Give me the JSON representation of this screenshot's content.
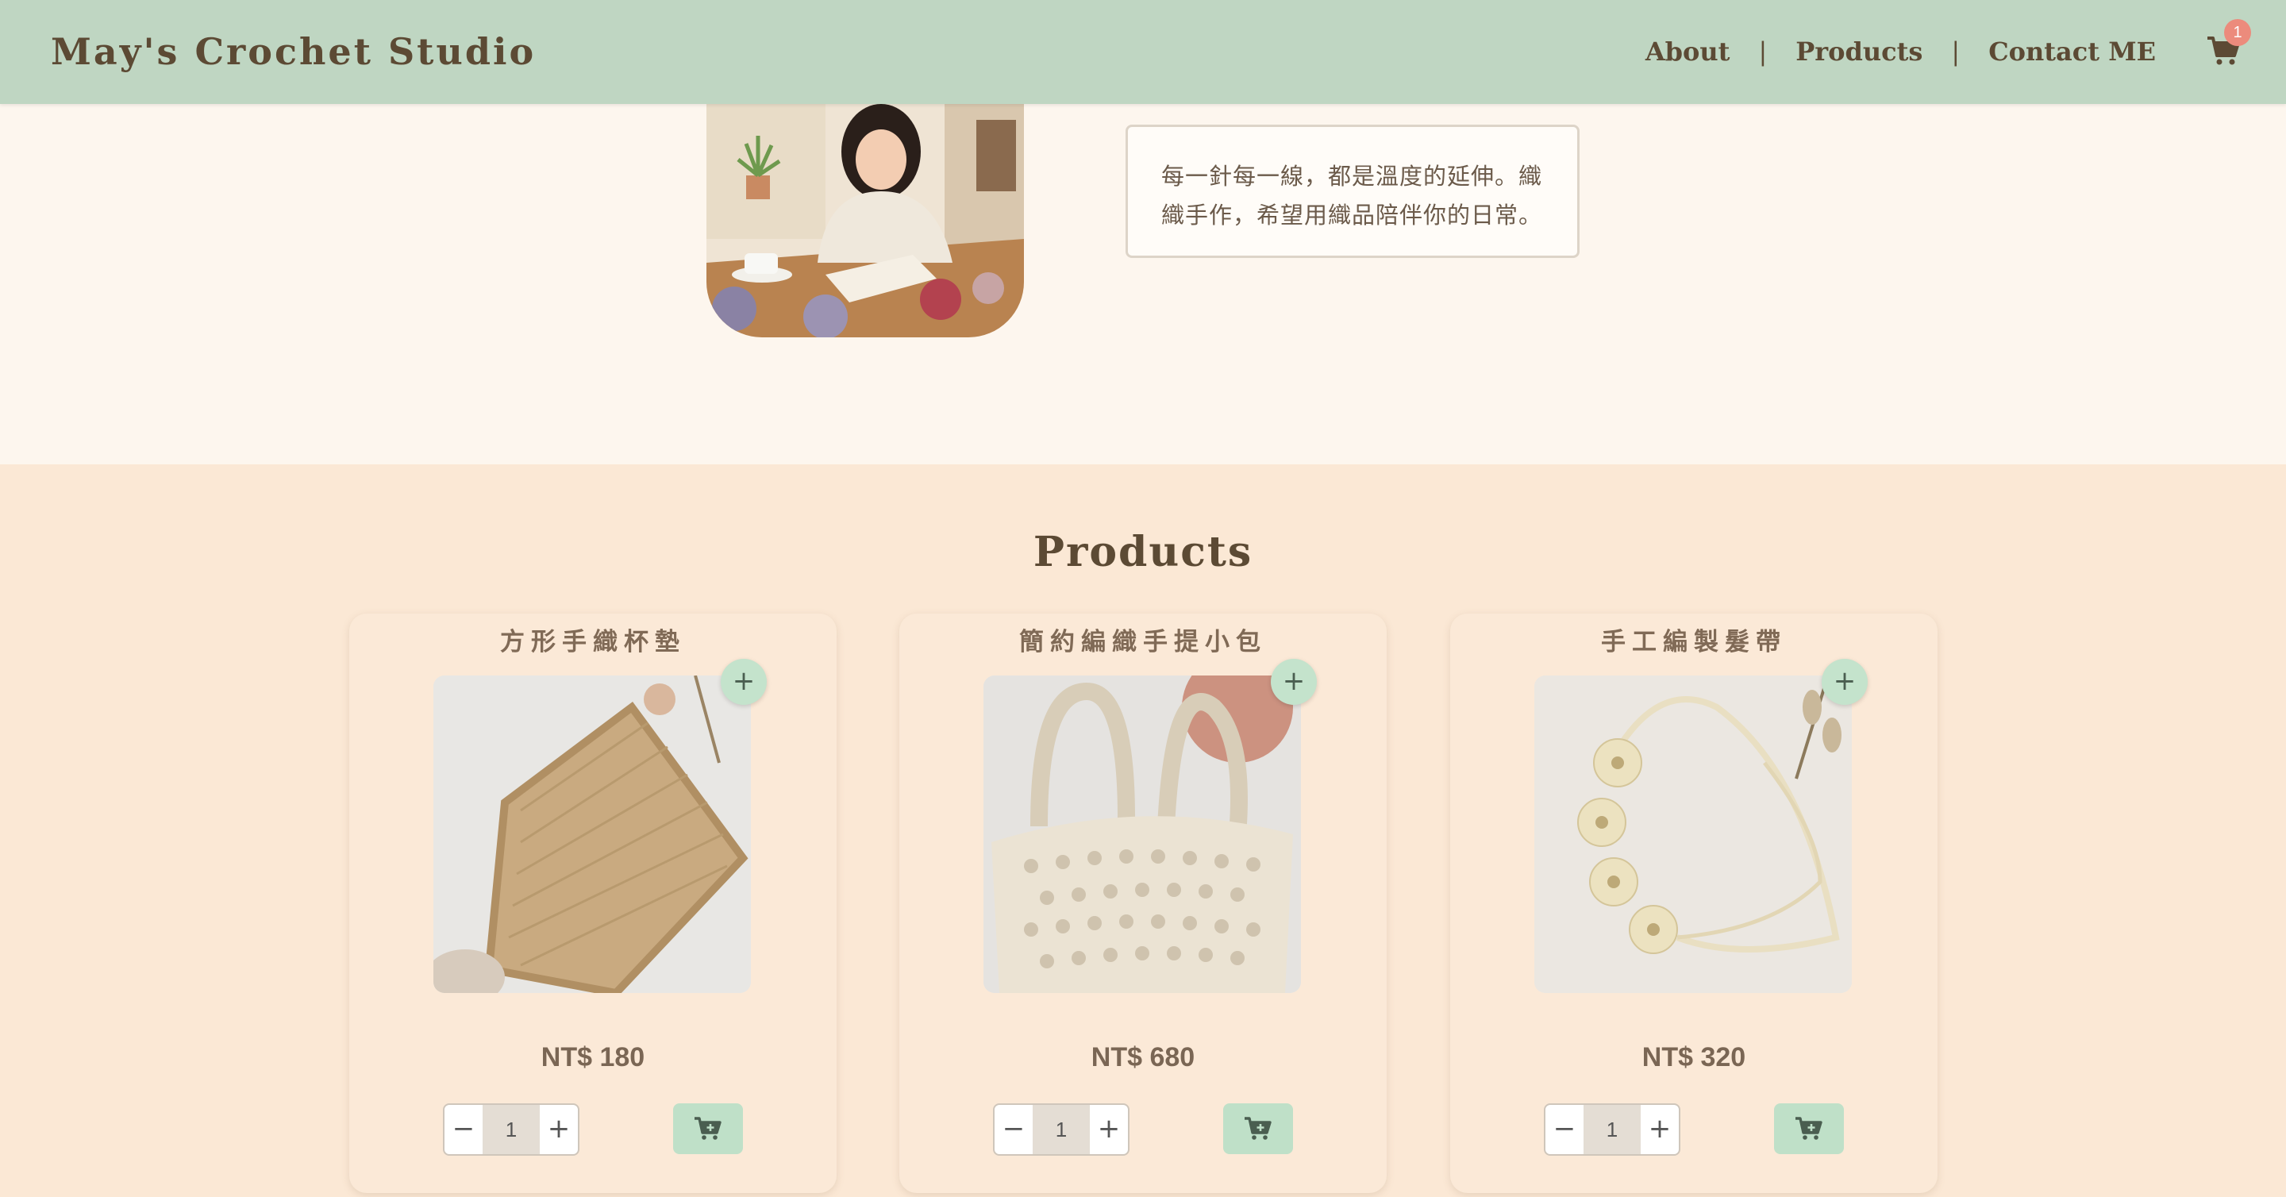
{
  "header": {
    "brand": "May's Crochet Studio",
    "nav": [
      {
        "label": "About"
      },
      {
        "label": "Products"
      },
      {
        "label": "Contact ME"
      }
    ],
    "nav_separator": "|",
    "cart_count": "1",
    "cart_icon": "cart-icon"
  },
  "about": {
    "image": "woman-crocheting-illustration",
    "text": "每一針每一線，都是溫度的延伸。織織手作，希望用織品陪伴你的日常。"
  },
  "products": {
    "title": "Products",
    "items": [
      {
        "name": "方形手織杯墊",
        "price": "NT$ 180",
        "qty": "1",
        "image": "square-crochet-coaster"
      },
      {
        "name": "簡約編織手提小包",
        "price": "NT$ 680",
        "qty": "1",
        "image": "crochet-tote-bag"
      },
      {
        "name": "手工編製髮帶",
        "price": "NT$ 320",
        "qty": "1",
        "image": "crochet-flower-headband"
      }
    ],
    "plus_label": "+",
    "minus_label": "−",
    "add_label": "+",
    "add_to_cart_icon": "cart-add-icon"
  },
  "colors": {
    "header_bg": "#bfd6c2",
    "page_bg": "#fdf6ee",
    "products_bg": "#fbe8d5",
    "accent_green": "#bfe0c8",
    "badge": "#ec8b7c",
    "text_brown": "#5c4a34"
  }
}
